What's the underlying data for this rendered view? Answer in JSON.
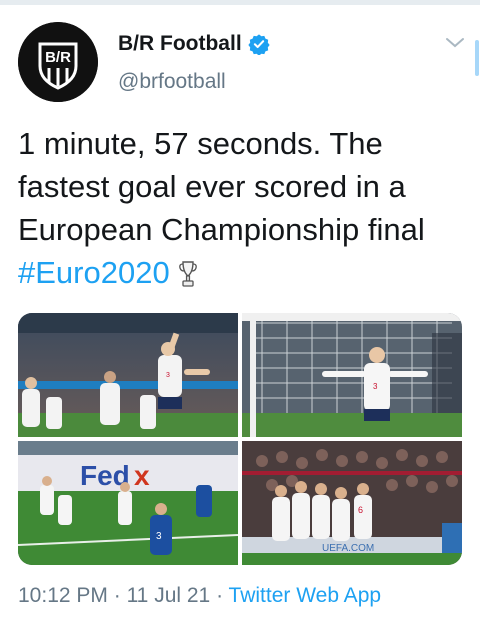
{
  "account": {
    "display_name": "B/R Football",
    "handle": "@brfootball",
    "verified": true,
    "avatar_logo_text": "B/R"
  },
  "tweet": {
    "text": "1 minute, 57 seconds. The fastest goal ever scored in a European Championship final",
    "hashtag": "#Euro2020",
    "emoji": "trophy-icon"
  },
  "media": [
    {
      "label": "photo-1"
    },
    {
      "label": "photo-2"
    },
    {
      "label": "photo-3"
    },
    {
      "label": "photo-4"
    }
  ],
  "meta": {
    "time": "10:12 PM",
    "separator": " · ",
    "date": "11 Jul 21",
    "source": "Twitter Web App"
  },
  "colors": {
    "accent": "#1da1f2",
    "text": "#14171a",
    "muted": "#657786"
  }
}
